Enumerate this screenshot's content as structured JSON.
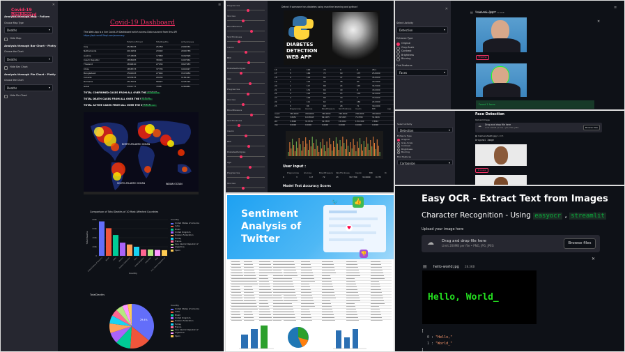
{
  "covid": {
    "sidebar": {
      "title": "Covid-19 Dashboard",
      "map_heading": "Analysis through Map - Folium",
      "map_type_label": "Choose Map Type",
      "map_type_value": "Deaths",
      "hide_map": "Hide Map",
      "bar_heading": "Analysis through Bar Chart - Plotly",
      "bar_choose": "Choose the Chart",
      "bar_value": "Deaths",
      "hide_bar": "Hide Bar Chart",
      "pie_heading": "Analysis through Pie Chart - Plotly",
      "pie_choose": "Choose the Chart",
      "pie_value": "Deaths",
      "hide_pie": "Hide Pie Chart"
    },
    "title": "Covid-19 Dashboard",
    "intro": "This Web App is a live Covid-19 Dashboard which access Data sourced from this API",
    "link": "https://api.covid19api.com/summary",
    "table": {
      "headers": [
        "",
        "TotalConfirmed",
        "TotalDeaths",
        "ActiveCases"
      ],
      "rows": [
        [
          "Iraq",
          "2528033",
          "25358",
          "2499334"
        ],
        [
          "Netherlands",
          "2019952",
          "23092",
          "2004738"
        ],
        [
          "Austria",
          "1710656",
          "17868",
          "1692098"
        ],
        [
          "Czech Republic",
          "1858083",
          "38091",
          "1907064"
        ],
        [
          "Thailand",
          "1849410",
          "27434",
          "1827483"
        ],
        [
          "Chile",
          "1858373",
          "37735",
          "1914917"
        ],
        [
          "Bangladesh",
          "1561463",
          "27604",
          "1513089"
        ],
        [
          "Canada",
          "1203415",
          "29434",
          "1161021"
        ],
        [
          "Romania",
          "1515021",
          "58927",
          "1225194"
        ],
        [
          "Israel",
          "1301777",
          "7966",
          "1284881"
        ]
      ]
    },
    "stats": [
      {
        "label": "TOTAL CONFIRMED CASES FROM ALL OVER THE WORLD",
        "value": "253683054"
      },
      {
        "label": "TOTAL DEATH CASES FROM ALL OVER THE WORLD",
        "value": "5120756"
      },
      {
        "label": "TOTAL ACTIVE CASES FROM ALL OVER THE WORLD",
        "value": "248562298"
      }
    ],
    "map_labels": [
      "NORTH ATLANTIC OCEAN",
      "SOUTH ATLANTIC OCEAN",
      "INDIAN OCEAN"
    ],
    "bar_title": "Comparison of Total Deaths of 10 Most Affected Countries",
    "pie_title": "TotalDeaths",
    "legend_title": "Country",
    "legend": [
      "United States of America",
      "India",
      "Brazil",
      "United Kingdom",
      "Russian Federation",
      "Turkey",
      "France",
      "Iran, Islamic Republic of",
      "Argentina",
      "Spain"
    ],
    "legend_colors": [
      "#636efa",
      "#ef553b",
      "#00cc96",
      "#ab63fa",
      "#ffa15a",
      "#19d3f3",
      "#ff6692",
      "#b6e880",
      "#ff97ff",
      "#fecb52"
    ]
  },
  "chart_data": [
    {
      "type": "bar",
      "title": "Comparison of Total Deaths of 10 Most Affected Countries",
      "xlabel": "Country",
      "ylabel": "Total Deaths",
      "categories": [
        "United States of America",
        "Brazil",
        "India",
        "Mexico",
        "Russian Federation",
        "Peru",
        "United Kingdom",
        "Indonesia",
        "Italy",
        "Iran, Islamic Republic of"
      ],
      "values": [
        760000,
        610000,
        460000,
        290000,
        250000,
        200000,
        140000,
        140000,
        130000,
        125000
      ],
      "ylim": [
        0,
        800000
      ],
      "yticks": [
        "0",
        "200k",
        "400k",
        "600k",
        "800k"
      ]
    },
    {
      "type": "pie",
      "title": "TotalDeaths",
      "values": [
        36,
        15,
        11,
        8,
        7,
        6,
        5,
        5,
        4,
        3
      ],
      "labels": [
        "29.4%",
        "",
        "",
        "",
        "",
        "",
        "",
        "",
        "",
        ""
      ]
    }
  ],
  "diabetes": {
    "slider_labels": [
      "Pregnancies",
      "Glucose",
      "BloodPressure",
      "SkinThickness",
      "Insulin",
      "BMI",
      "DiabetesPedigree",
      "Age"
    ],
    "banner": "Detect if someone has diabetes using machine learning and python !",
    "logo_line1": "DIABETES",
    "logo_line2": "DETECTION",
    "logo_line3": "WEB APP",
    "cols": [
      "Pregnancies",
      "Glucose",
      "BloodPressure",
      "SkinThickness",
      "Insulin",
      "BMI",
      "Age"
    ],
    "rows": [
      [
        "16",
        "1",
        "100",
        "70",
        "0",
        "0",
        "28.1"
      ],
      [
        "17",
        "5",
        "166",
        "72",
        "19",
        "175",
        "25.8000"
      ],
      [
        "18",
        "0",
        "118",
        "84",
        "47",
        "230",
        "45.8000"
      ],
      [
        "19",
        "1",
        "103",
        "30",
        "38",
        "83",
        "43.3000"
      ],
      [
        "20",
        "1",
        "117",
        "88",
        "24",
        "145",
        "34.5000"
      ],
      [
        "21",
        "0",
        "131",
        "66",
        "40",
        "0",
        "43.0000"
      ],
      [
        "22",
        "4",
        "123",
        "80",
        "15",
        "176",
        "32.0000"
      ],
      [
        "23",
        "4",
        "109",
        "88",
        "30",
        "1",
        "33.6000"
      ],
      [
        "24",
        "1",
        "111",
        "62",
        "13",
        "182",
        "24.0000"
      ],
      [
        "25",
        "5",
        "86",
        "68",
        "28",
        "71",
        "30.2000"
      ]
    ],
    "stats": [
      [
        "count",
        "768.0000",
        "768.0000",
        "768.0000",
        "768.0000",
        "768.0000",
        "768.0000"
      ],
      [
        "mean",
        "3.8451",
        "120.8945",
        "69.1055",
        "20.5365",
        "79.7995",
        "31.9926"
      ],
      [
        "std",
        "3.3696",
        "31.9726",
        "19.3558",
        "15.9522",
        "115.2440",
        "7.8842"
      ],
      [
        "min",
        "0.0000",
        "0.0000",
        "0.0000",
        "0.0000",
        "0.0000",
        "0.0000"
      ]
    ],
    "user_input": "User input :",
    "input_cols": [
      "Pregnancies",
      "Glucose",
      "BloodPressure",
      "SkinThickness",
      "Insulin",
      "BMI",
      "Di"
    ],
    "input_row": [
      "0",
      "3",
      "117",
      "72",
      "23",
      "30.7700",
      "32.0000",
      "0.375"
    ],
    "accuracy": "Model Test Accuracy Score:"
  },
  "face": {
    "select_activity": "Select Activity",
    "activity": "Detection",
    "enhance_type": "Enhance Type",
    "options": [
      "Original",
      "Gray-Scale",
      "Contrast",
      "Brightness",
      "Blurring"
    ],
    "find_features": "Find Features",
    "features": "Faces",
    "file_name": "elon-musk.jpg",
    "file_size": "12.9KB",
    "original_image": "Original Image",
    "process_btn": "Process",
    "found": "Found 1 faces",
    "title2": "Face Detection",
    "upload_label": "Upload Image",
    "drop_text": "Drag and drop file here",
    "limit_text": "Limit 200MB per file • JPG, PNG, JPEG",
    "browse": "Browse files",
    "file2": "mamunshaikh.jpg",
    "file2_size": "6.4KB",
    "original2": "Original Image",
    "process2": "Process",
    "activity2": "Detection",
    "features2": "Cartoonize"
  },
  "sentiment": {
    "title_line1": "Sentiment",
    "title_line2": "Analysis of",
    "title_line3": "Twitter"
  },
  "ocr": {
    "title": "Easy OCR - Extract Text from Images",
    "subtitle_prefix": "Character Recognition - Using",
    "tag1": "easyocr",
    "tag2": "streamlit",
    "upload_label": "Upload your image here",
    "drop_text": "Drag and drop file here",
    "limit_text": "Limit 200MB per file • PNG, JPG, JPEG",
    "browse": "Browse files",
    "file_name": "hello-world.jpg",
    "file_size": "28.3KB",
    "ocr_image_text": "Hello, World_",
    "json_open": "[",
    "json_0_key": "0",
    "json_0_val": "\"Hello,\"",
    "json_1_key": "1",
    "json_1_val": "\"World_\"",
    "json_close": "]"
  }
}
